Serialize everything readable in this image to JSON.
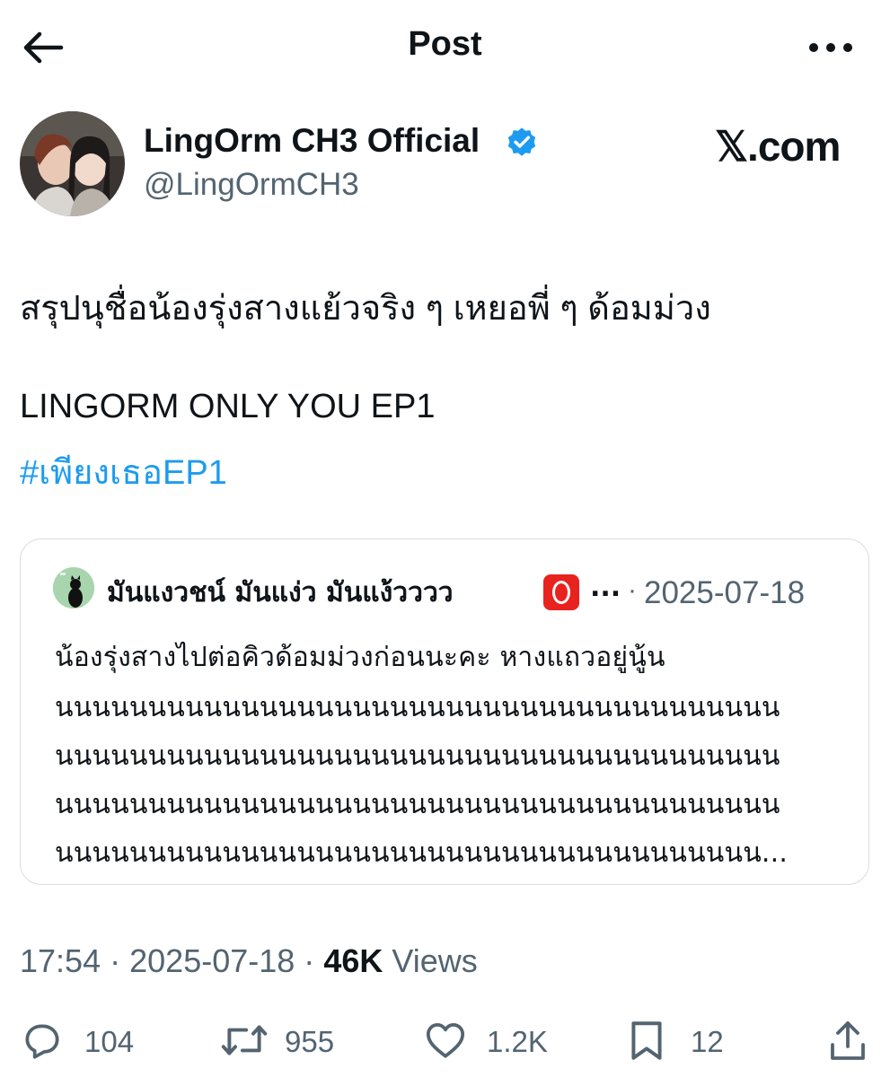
{
  "header": {
    "title": "Post",
    "back_icon": "arrow-left-icon",
    "more_icon": "more-horizontal-icon"
  },
  "author": {
    "display_name": "LingOrm CH3 Official",
    "handle": "@LingOrmCH3",
    "verified": true,
    "verified_color": "#1d9bf0"
  },
  "watermark": "𝕏.com",
  "tweet": {
    "line1": "สรุปนุชื่อน้องรุ่งสางแย้วจริง ๆ เหยอพี่ ๆ ด้อมม่วง",
    "line2": "LINGORM ONLY YOU EP1",
    "hashtag": "#เพียงเธอEP1",
    "hashtag_color": "#1d9bf0"
  },
  "quote": {
    "name": "มันแงวชน์ มันแง่ว มันแง้วววว",
    "badge": "⭕",
    "ellipsis": "...",
    "separator": "·",
    "date": "2025-07-18",
    "lines": [
      "น้องรุ่งสางไปต่อคิวด้อมม่วงก่อนนะคะ หางแถวอยู่นู้น",
      "นนนนนนนนนนนนนนนนนนนนนนนนนนนนนนนนนนนนนนน",
      "นนนนนนนนนนนนนนนนนนนนนนนนนนนนนนนนนนนนนนน",
      "นนนนนนนนนนนนนนนนนนนนนนนนนนนนนนนนนนนนนนน",
      "นนนนนนนนนนนนนนนนนนนนนนนนนนนนนนนนนนนนนน..."
    ]
  },
  "meta": {
    "time": "17:54",
    "separator": "·",
    "date": "2025-07-18",
    "views_count": "46K",
    "views_label": "Views"
  },
  "actions": {
    "replies": "104",
    "reposts": "955",
    "likes": "1.2K",
    "bookmarks": "12",
    "icons": [
      "reply-icon",
      "repost-icon",
      "like-icon",
      "bookmark-icon",
      "share-icon"
    ]
  }
}
